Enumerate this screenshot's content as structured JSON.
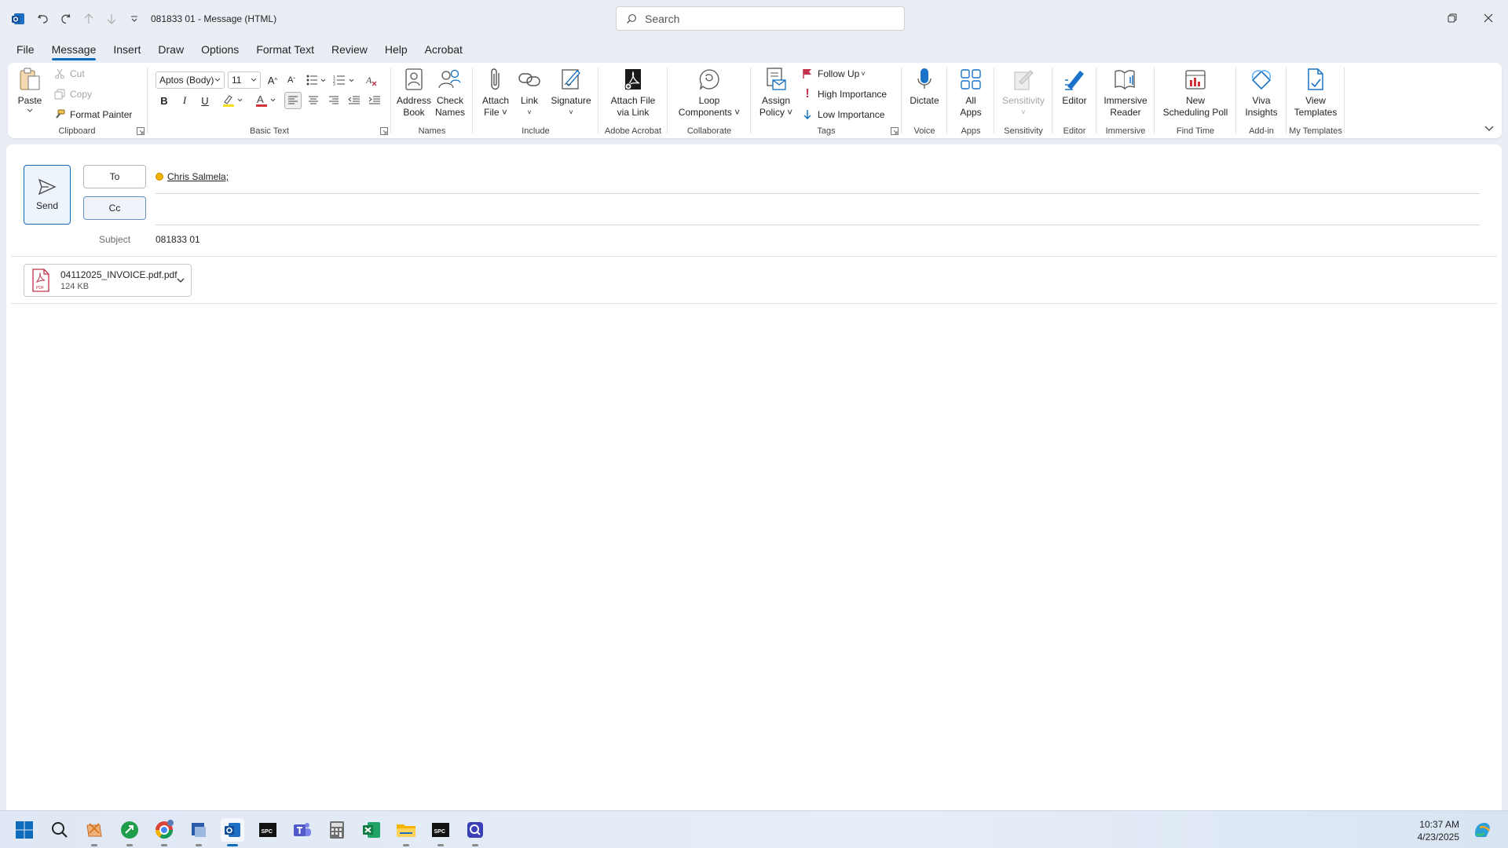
{
  "window": {
    "title": "081833 01  -  Message (HTML)",
    "search_placeholder": "Search"
  },
  "tabs": [
    "File",
    "Message",
    "Insert",
    "Draw",
    "Options",
    "Format Text",
    "Review",
    "Help",
    "Acrobat"
  ],
  "active_tab": "Message",
  "ribbon": {
    "clipboard": {
      "paste": "Paste",
      "cut": "Cut",
      "copy": "Copy",
      "format_painter": "Format Painter",
      "label": "Clipboard"
    },
    "basic_text": {
      "font": "Aptos (Body)",
      "size": "11",
      "label": "Basic Text"
    },
    "names": {
      "address_book_1": "Address",
      "address_book_2": "Book",
      "check_names_1": "Check",
      "check_names_2": "Names",
      "label": "Names"
    },
    "include": {
      "attach_1": "Attach",
      "attach_2": "File",
      "link": "Link",
      "signature": "Signature",
      "label": "Include"
    },
    "adobe": {
      "btn_1": "Attach File",
      "btn_2": "via Link",
      "label": "Adobe Acrobat"
    },
    "collaborate": {
      "btn_1": "Loop",
      "btn_2": "Components",
      "label": "Collaborate"
    },
    "tags": {
      "assign_1": "Assign",
      "assign_2": "Policy",
      "follow_up": "Follow Up",
      "high": "High Importance",
      "low": "Low Importance",
      "label": "Tags"
    },
    "voice": {
      "btn": "Dictate",
      "label": "Voice"
    },
    "apps": {
      "btn_1": "All",
      "btn_2": "Apps",
      "label": "Apps"
    },
    "sensitivity": {
      "btn": "Sensitivity",
      "label": "Sensitivity"
    },
    "editor": {
      "btn": "Editor",
      "label": "Editor"
    },
    "immersive": {
      "btn_1": "Immersive",
      "btn_2": "Reader",
      "label": "Immersive"
    },
    "find_time": {
      "btn_1": "New",
      "btn_2": "Scheduling Poll",
      "label": "Find Time"
    },
    "addin": {
      "btn_1": "Viva",
      "btn_2": "Insights",
      "label": "Add-in"
    },
    "templates": {
      "btn_1": "View",
      "btn_2": "Templates",
      "label": "My Templates"
    }
  },
  "compose": {
    "send": "Send",
    "to_label": "To",
    "cc_label": "Cc",
    "to_recipient": "Chris Salmela;",
    "subject_label": "Subject",
    "subject": "081833 01",
    "attachment": {
      "name": "04112025_INVOICE.pdf.pdf",
      "size": "124 KB",
      "type_badge": "PDF"
    }
  },
  "taskbar": {
    "time": "10:37 AM",
    "date": "4/23/2025",
    "icons": [
      "windows-start-icon",
      "search-icon",
      "app-icon",
      "app-green-icon",
      "chrome-icon",
      "app-icon",
      "outlook-icon",
      "spc-icon",
      "teams-icon",
      "calculator-icon",
      "excel-icon",
      "file-explorer-icon",
      "spc-icon",
      "app-icon"
    ],
    "spc_label": "SPC"
  },
  "colors": {
    "accent": "#0f6cbd",
    "background": "#e9eef5"
  }
}
